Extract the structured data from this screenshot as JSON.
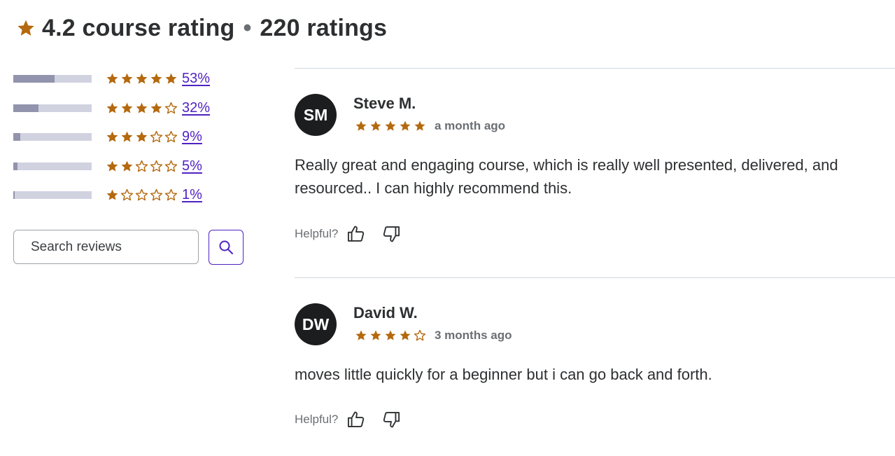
{
  "header": {
    "rating": "4.2 course rating",
    "separator": "•",
    "count": "220 ratings"
  },
  "distribution": [
    {
      "stars": 5,
      "percent_label": "53%",
      "fraction": 0.53
    },
    {
      "stars": 4,
      "percent_label": "32%",
      "fraction": 0.32
    },
    {
      "stars": 3,
      "percent_label": "9%",
      "fraction": 0.09
    },
    {
      "stars": 2,
      "percent_label": "5%",
      "fraction": 0.05
    },
    {
      "stars": 1,
      "percent_label": "1%",
      "fraction": 0.01
    }
  ],
  "search": {
    "placeholder": "Search reviews",
    "button_icon": "search-icon"
  },
  "reviews": [
    {
      "initials": "SM",
      "name": "Steve M.",
      "stars": 5,
      "time": "a month ago",
      "text": "Really great and engaging course, which is really well presented, delivered, and resourced.. I can highly recommend this.",
      "helpful_label": "Helpful?"
    },
    {
      "initials": "DW",
      "name": "David W.",
      "stars": 4,
      "time": "3 months ago",
      "text": "moves little quickly for a beginner but i can go back and forth.",
      "helpful_label": "Helpful?"
    }
  ],
  "colors": {
    "star": "#b4690e",
    "link": "#5022c3",
    "bar_track": "#d1d2e0",
    "bar_fill": "#9194ac",
    "avatar_bg": "#1c1d1f"
  }
}
